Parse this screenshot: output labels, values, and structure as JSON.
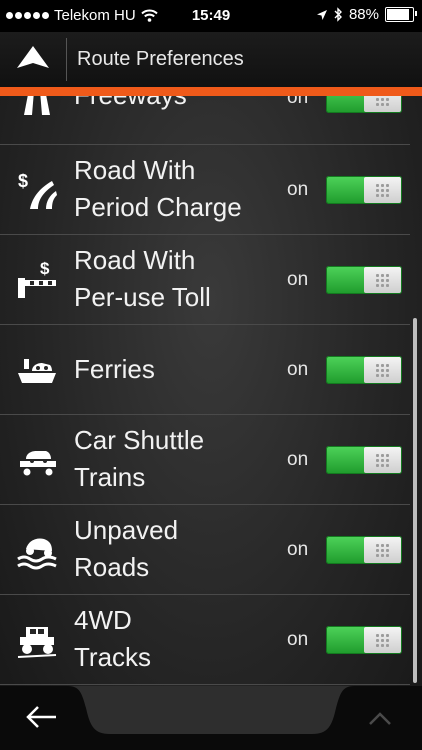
{
  "status_bar": {
    "carrier": "Telekom HU",
    "time": "15:49",
    "battery": "88%",
    "battery_level": 0.88
  },
  "header": {
    "title": "Route Preferences",
    "nav_icon": "navigation-arrow-icon"
  },
  "rows": [
    {
      "label": "Freeways",
      "state": "on",
      "icon": "freeway-icon",
      "enabled": true
    },
    {
      "label": "Road With\nPeriod Charge",
      "state": "on",
      "icon": "period-charge-road-icon",
      "enabled": true
    },
    {
      "label": "Road With\nPer-use Toll",
      "state": "on",
      "icon": "toll-barrier-icon",
      "enabled": true
    },
    {
      "label": "Ferries",
      "state": "on",
      "icon": "ferry-icon",
      "enabled": true
    },
    {
      "label": "Car Shuttle\nTrains",
      "state": "on",
      "icon": "car-shuttle-train-icon",
      "enabled": true
    },
    {
      "label": "Unpaved\nRoads",
      "state": "on",
      "icon": "unpaved-road-icon",
      "enabled": true
    },
    {
      "label": "4WD\nTracks",
      "state": "on",
      "icon": "4wd-track-icon",
      "enabled": true
    }
  ],
  "footer": {
    "back_icon": "back-arrow-icon",
    "up_icon": "chevron-up-icon"
  },
  "colors": {
    "accent": "#ef5a1a",
    "toggle_on": "#2fb63c",
    "background": "#262626"
  }
}
